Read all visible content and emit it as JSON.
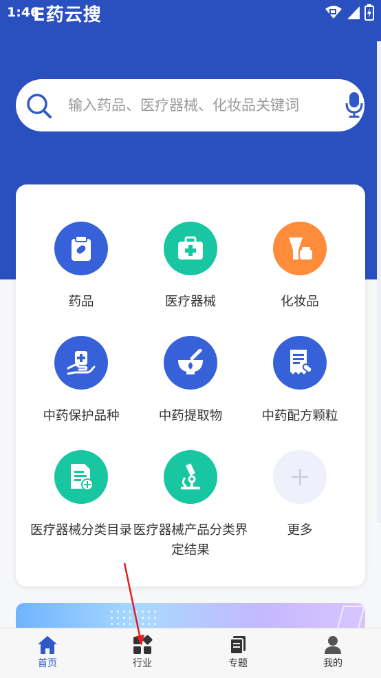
{
  "status_bar": {
    "time": "1:46",
    "app_title": "E药云搜"
  },
  "search": {
    "placeholder": "输入药品、医疗器械、化妆品关键词"
  },
  "categories": [
    {
      "label": "药品",
      "icon": "medicine-box-icon",
      "color": "#3661d8"
    },
    {
      "label": "医疗器械",
      "icon": "first-aid-kit-icon",
      "color": "#18c6a1"
    },
    {
      "label": "化妆品",
      "icon": "cosmetics-icon",
      "color": "#ff8c3b"
    },
    {
      "label": "中药保护品种",
      "icon": "hand-holding-medicine-icon",
      "color": "#3661d8"
    },
    {
      "label": "中药提取物",
      "icon": "mortar-icon",
      "color": "#3661d8"
    },
    {
      "label": "中药配方颗粒",
      "icon": "prescription-icon",
      "color": "#3661d8"
    },
    {
      "label": "医疗器械分类目录",
      "icon": "medical-document-icon",
      "color": "#18c6a1"
    },
    {
      "label": "医疗器械产品分类界定结果",
      "icon": "microscope-icon",
      "color": "#18c6a1"
    },
    {
      "label": "更多",
      "icon": "plus-icon",
      "color": "#eef0fb"
    }
  ],
  "tabs": [
    {
      "label": "首页",
      "icon": "home-icon",
      "active": true
    },
    {
      "label": "行业",
      "icon": "grid-icon",
      "active": false
    },
    {
      "label": "专题",
      "icon": "documents-icon",
      "active": false
    },
    {
      "label": "我的",
      "icon": "user-icon",
      "active": false
    }
  ],
  "colors": {
    "primary": "#2a50c0",
    "active_tab": "#2f58c8",
    "annotation_arrow": "#e02020"
  }
}
